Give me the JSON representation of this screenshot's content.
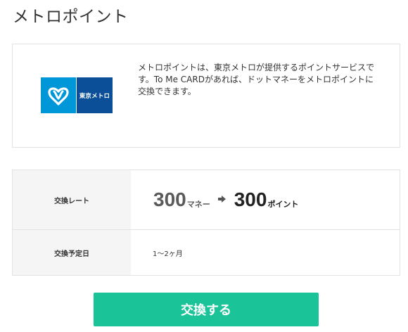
{
  "page": {
    "title": "メトロポイント"
  },
  "intro": {
    "logo_text": "東京メトロ",
    "description": "メトロポイントは、東京メトロが提供するポイントサービスです。To Me CARDがあれば、ドットマネーをメトロポイントに交換できます。"
  },
  "rate_table": {
    "rate_label": "交換レート",
    "from_amount": "300",
    "from_unit": "マネー",
    "to_amount": "300",
    "to_unit": "ポイント",
    "schedule_label": "交換予定日",
    "schedule_value": "1〜2ヶ月"
  },
  "exchange_button": {
    "label": "交換する"
  },
  "colors": {
    "button": "#1ac398",
    "logo_light_blue": "#0097d8",
    "logo_dark_blue": "#0a4f97"
  }
}
